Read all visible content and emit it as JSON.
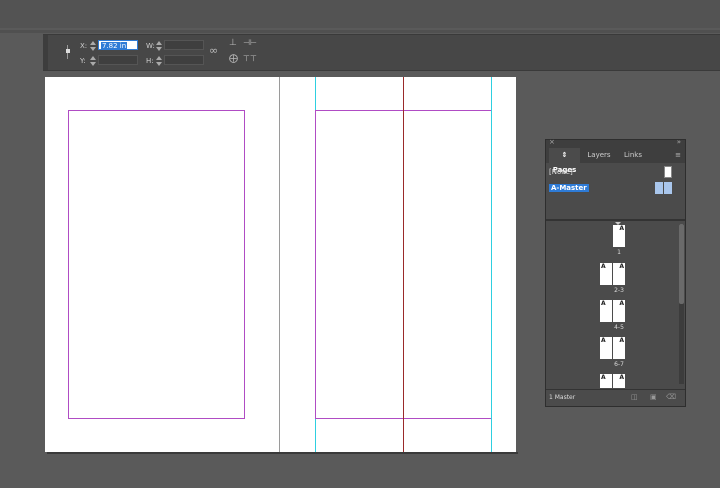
{
  "control_bar": {
    "x_label": "X:",
    "x_value": "7.82 in",
    "y_label": "Y:",
    "y_value": "",
    "w_label": "W:",
    "w_value": "",
    "h_label": "H:",
    "h_value": ""
  },
  "pages_panel": {
    "tabs": [
      {
        "label": "Pages"
      },
      {
        "label": "Layers"
      },
      {
        "label": "Links"
      }
    ],
    "masters": [
      {
        "name": "[None]"
      },
      {
        "name": "A-Master"
      }
    ],
    "page_letter": "A",
    "page_labels": [
      "1",
      "2-3",
      "4-5",
      "6-7"
    ],
    "footer_text": "1 Master"
  },
  "colors": {
    "margin_guide": "#b04cc4",
    "column_guide": "#2ecfe0",
    "spine": "#9a2a2a",
    "selection": "#2e7bd6"
  }
}
